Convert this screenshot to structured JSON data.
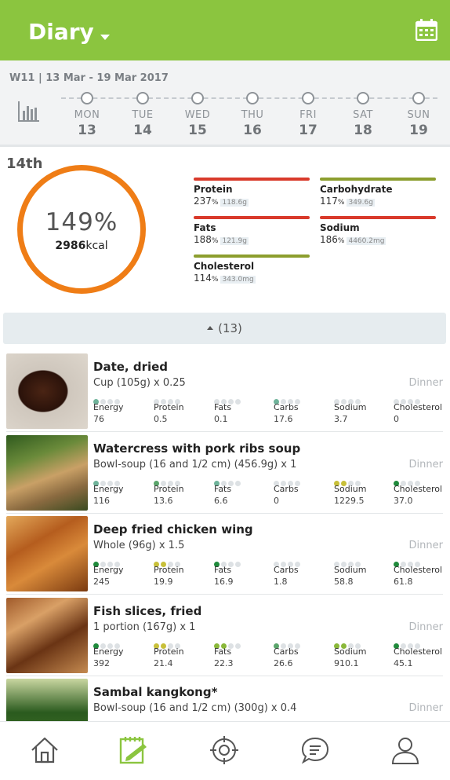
{
  "header": {
    "title": "Diary",
    "icons": [
      "dropdown-caret-icon",
      "calendar-icon"
    ]
  },
  "week": {
    "range": "W11 | 13 Mar - 19 Mar 2017",
    "days": [
      {
        "name": "MON",
        "num": "13"
      },
      {
        "name": "TUE",
        "num": "14"
      },
      {
        "name": "WED",
        "num": "15"
      },
      {
        "name": "THU",
        "num": "16"
      },
      {
        "name": "FRI",
        "num": "17"
      },
      {
        "name": "SAT",
        "num": "18"
      },
      {
        "name": "SUN",
        "num": "19"
      }
    ]
  },
  "summary": {
    "date": "14th",
    "percent": "149%",
    "kcal_value": "2986",
    "kcal_unit": "kcal",
    "nutrients": [
      {
        "name": "Protein",
        "pct": "237",
        "pct_unit": "%",
        "amount": "118.6g",
        "color": "#d93a2b"
      },
      {
        "name": "Carbohydrate",
        "pct": "117",
        "pct_unit": "%",
        "amount": "349.6g",
        "color": "#8c9e2e"
      },
      {
        "name": "Fats",
        "pct": "188",
        "pct_unit": "%",
        "amount": "121.9g",
        "color": "#d93a2b"
      },
      {
        "name": "Sodium",
        "pct": "186",
        "pct_unit": "%",
        "amount": "4460.2mg",
        "color": "#d93a2b"
      },
      {
        "name": "Cholesterol",
        "pct": "114",
        "pct_unit": "%",
        "amount": "343.0mg",
        "color": "#8c9e2e"
      }
    ]
  },
  "collapse_label": "(13)",
  "nutrient_labels": [
    "Energy",
    "Protein",
    "Fats",
    "Carbs",
    "Sodium",
    "Cholesterol"
  ],
  "dot_colors": {
    "green": "#5aa56b",
    "darkgreen": "#1f8a3b",
    "yellow": "#c8c03a",
    "lime": "#8ab83a",
    "teal": "#6fb39a",
    "grey": "#dde1e4"
  },
  "foods": [
    {
      "name": "Date, dried",
      "serving": "Cup (105g) x 0.25",
      "meal": "Dinner",
      "values": [
        "76",
        "0.5",
        "0.1",
        "17.6",
        "3.7",
        "0"
      ],
      "dots": [
        [
          "teal"
        ],
        [],
        [],
        [
          "teal"
        ],
        [],
        []
      ]
    },
    {
      "name": "Watercress with pork ribs soup",
      "serving": "Bowl-soup (16 and 1/2 cm) (456.9g) x 1",
      "meal": "Dinner",
      "values": [
        "116",
        "13.6",
        "6.6",
        "0",
        "1229.5",
        "37.0"
      ],
      "dots": [
        [
          "teal"
        ],
        [
          "green"
        ],
        [
          "teal"
        ],
        [],
        [
          "yellow",
          "yellow"
        ],
        [
          "darkgreen"
        ]
      ]
    },
    {
      "name": "Deep fried chicken wing",
      "serving": "Whole (96g) x 1.5",
      "meal": "Dinner",
      "values": [
        "245",
        "19.9",
        "16.9",
        "1.8",
        "58.8",
        "61.8"
      ],
      "dots": [
        [
          "darkgreen"
        ],
        [
          "yellow",
          "yellow"
        ],
        [
          "darkgreen"
        ],
        [
          "grey"
        ],
        [
          "grey"
        ],
        [
          "darkgreen"
        ]
      ]
    },
    {
      "name": "Fish slices, fried",
      "serving": "1 portion (167g) x 1",
      "meal": "Dinner",
      "values": [
        "392",
        "21.4",
        "22.3",
        "26.6",
        "910.1",
        "45.1"
      ],
      "dots": [
        [
          "darkgreen"
        ],
        [
          "yellow",
          "yellow"
        ],
        [
          "lime",
          "lime"
        ],
        [
          "green"
        ],
        [
          "lime",
          "lime"
        ],
        [
          "darkgreen"
        ]
      ]
    },
    {
      "name": "Sambal kangkong*",
      "serving": "Bowl-soup (16 and 1/2 cm) (300g) x 0.4",
      "meal": "Dinner",
      "values": [
        "",
        "",
        "",
        "",
        "",
        ""
      ],
      "dots": [
        [],
        [],
        [],
        [],
        [],
        []
      ]
    }
  ],
  "bottom_nav": [
    "home-icon",
    "diary-icon",
    "goals-icon",
    "chat-icon",
    "profile-icon"
  ]
}
